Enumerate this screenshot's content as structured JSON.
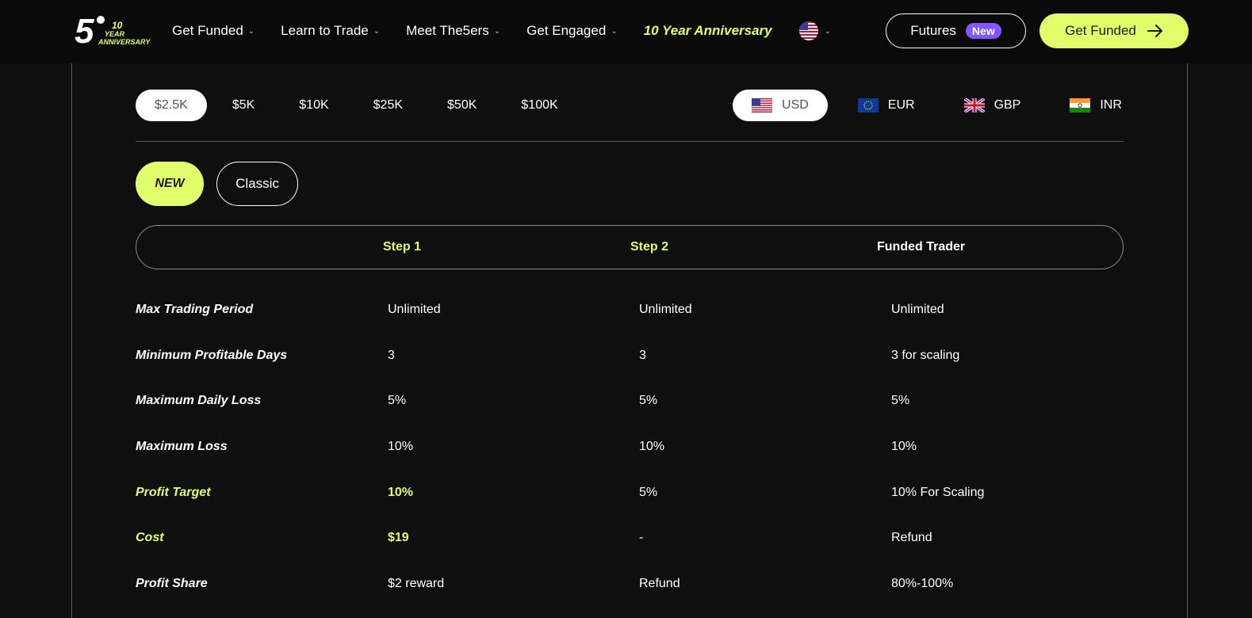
{
  "header": {
    "logo_text_main": "5",
    "logo_text_sub1": "10",
    "logo_text_sub2": "YEAR",
    "logo_text_sub3": "ANNIVERSARY",
    "nav": [
      {
        "label": "Get Funded",
        "dropdown": true
      },
      {
        "label": "Learn to Trade",
        "dropdown": true
      },
      {
        "label": "Meet The5ers",
        "dropdown": true
      },
      {
        "label": "Get Engaged",
        "dropdown": true
      }
    ],
    "anniversary_link": "10 Year Anniversary",
    "language_flag": "us-flag-icon",
    "futures_label": "Futures",
    "futures_badge": "New",
    "cta_label": "Get Funded",
    "accent_color": "#e1ff6b",
    "badge_color": "#8257ff"
  },
  "sizes": {
    "options": [
      "$2.5K",
      "$5K",
      "$10K",
      "$25K",
      "$50K",
      "$100K"
    ],
    "selected": "$2.5K"
  },
  "currencies": {
    "options": [
      {
        "code": "USD",
        "flag": "us-flag-icon"
      },
      {
        "code": "EUR",
        "flag": "eu-flag-icon"
      },
      {
        "code": "GBP",
        "flag": "uk-flag-icon"
      },
      {
        "code": "INR",
        "flag": "india-flag-icon"
      }
    ],
    "selected": "USD"
  },
  "program_types": {
    "new_label": "NEW",
    "classic_label": "Classic",
    "selected": "NEW"
  },
  "steps": {
    "step1": "Step 1",
    "step2": "Step 2",
    "funded": "Funded Trader"
  },
  "table": {
    "rows": [
      {
        "label": "Max Trading Period",
        "step1": "Unlimited",
        "step2": "Unlimited",
        "funded": "Unlimited",
        "highlight": false
      },
      {
        "label": "Minimum Profitable Days",
        "step1": "3",
        "step2": "3",
        "funded": "3 for scaling",
        "highlight": false
      },
      {
        "label": "Maximum Daily Loss",
        "step1": "5%",
        "step2": "5%",
        "funded": "5%",
        "highlight": false
      },
      {
        "label": "Maximum Loss",
        "step1": "10%",
        "step2": "10%",
        "funded": "10%",
        "highlight": false
      },
      {
        "label": "Profit Target",
        "step1": "10%",
        "step2": "5%",
        "funded": "10% For Scaling",
        "highlight": true
      },
      {
        "label": "Cost",
        "step1": "$19",
        "step2": "-",
        "funded": "Refund",
        "highlight": true
      },
      {
        "label": "Profit Share",
        "step1": "$2 reward",
        "step2": "Refund",
        "funded": "80%-100%",
        "highlight": false
      }
    ]
  }
}
